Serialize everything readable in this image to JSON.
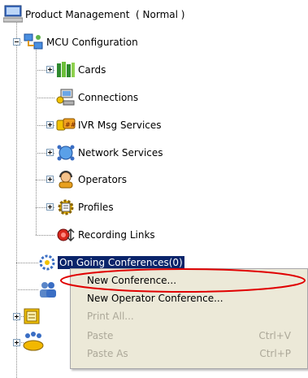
{
  "tree": {
    "root_label": "Product Management  ( Normal )",
    "mcu_configuration": "MCU Configuration",
    "children": [
      {
        "label": "Cards",
        "icon": "cards-books-icon"
      },
      {
        "label": "Connections",
        "icon": "connections-computer-icon"
      },
      {
        "label": "IVR Msg Services",
        "icon": "ivr-messages-icon"
      },
      {
        "label": "Network Services",
        "icon": "network-services-icon"
      },
      {
        "label": "Operators",
        "icon": "operators-person-icon"
      },
      {
        "label": "Profiles",
        "icon": "profiles-gear-icon"
      },
      {
        "label": "Recording Links",
        "icon": "recording-link-icon"
      }
    ],
    "selected_label": "On Going Conferences(0)"
  },
  "context_menu": {
    "items": [
      {
        "label": "New Conference...",
        "shortcut": "",
        "enabled": true
      },
      {
        "label": "New Operator Conference...",
        "shortcut": "",
        "enabled": true
      },
      {
        "label": "Print All...",
        "shortcut": "",
        "enabled": false
      },
      {
        "label": "Paste",
        "shortcut": "Ctrl+V",
        "enabled": false
      },
      {
        "label": "Paste As",
        "shortcut": "Ctrl+P",
        "enabled": false
      }
    ],
    "highlight_color": "#e00000"
  }
}
